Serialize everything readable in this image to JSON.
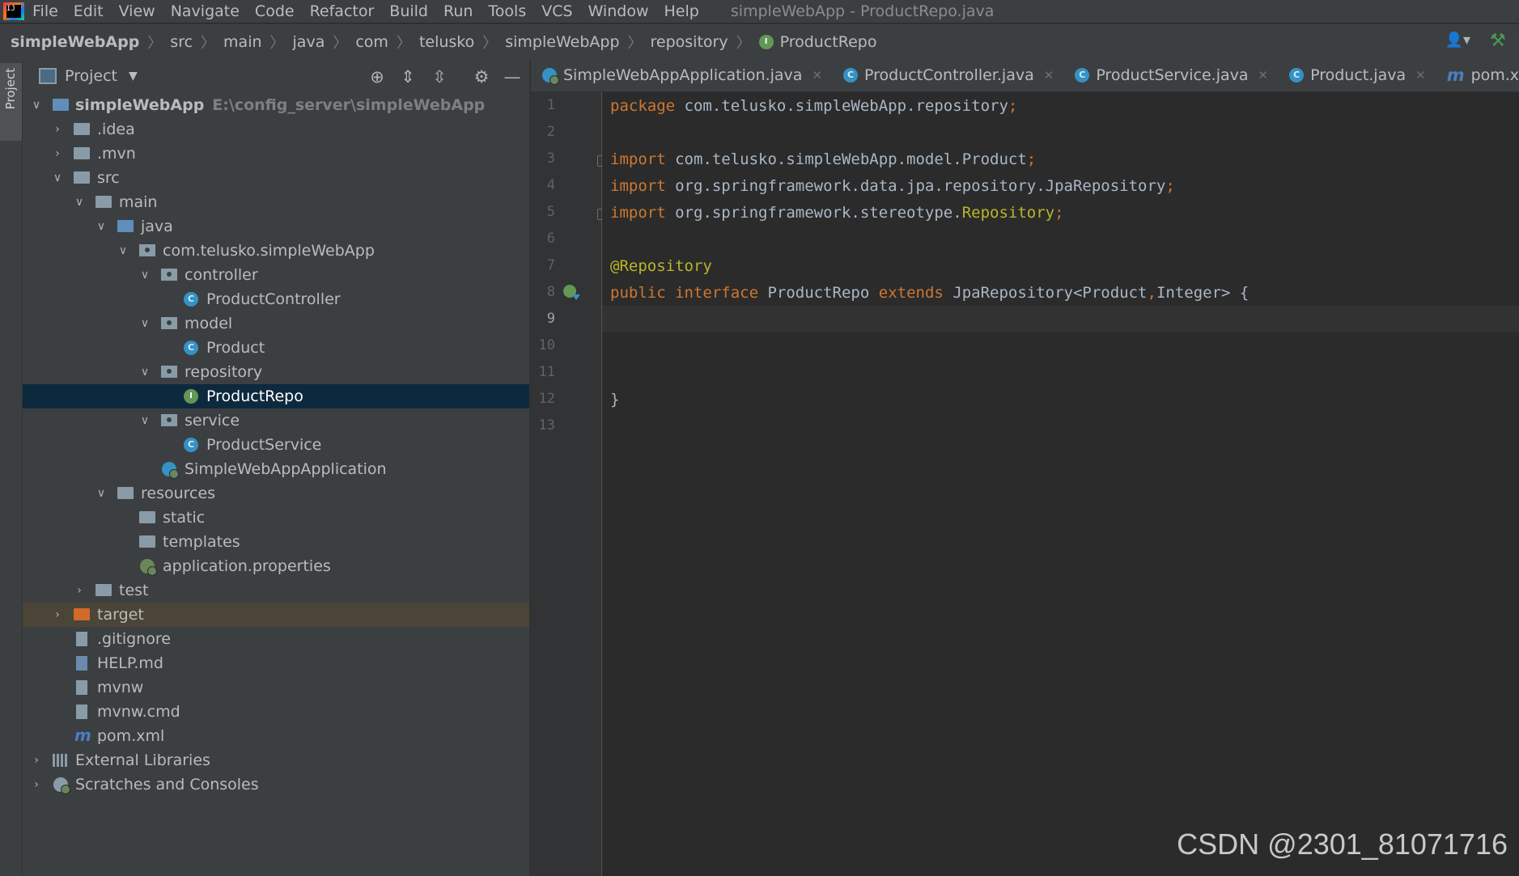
{
  "menu": {
    "items": [
      "File",
      "Edit",
      "View",
      "Navigate",
      "Code",
      "Refactor",
      "Build",
      "Run",
      "Tools",
      "VCS",
      "Window",
      "Help"
    ],
    "window_title": "simpleWebApp - ProductRepo.java"
  },
  "breadcrumb": [
    "simpleWebApp",
    "src",
    "main",
    "java",
    "com",
    "telusko",
    "simpleWebApp",
    "repository",
    "ProductRepo"
  ],
  "left_strip": {
    "project_tab": "Project"
  },
  "project_panel": {
    "title": "Project",
    "tree": [
      {
        "label": "simpleWebApp",
        "path": "E:\\config_server\\simpleWebApp"
      },
      {
        "label": ".idea"
      },
      {
        "label": ".mvn"
      },
      {
        "label": "src"
      },
      {
        "label": "main"
      },
      {
        "label": "java"
      },
      {
        "label": "com.telusko.simpleWebApp"
      },
      {
        "label": "controller"
      },
      {
        "label": "ProductController"
      },
      {
        "label": "model"
      },
      {
        "label": "Product"
      },
      {
        "label": "repository"
      },
      {
        "label": "ProductRepo"
      },
      {
        "label": "service"
      },
      {
        "label": "ProductService"
      },
      {
        "label": "SimpleWebAppApplication"
      },
      {
        "label": "resources"
      },
      {
        "label": "static"
      },
      {
        "label": "templates"
      },
      {
        "label": "application.properties"
      },
      {
        "label": "test"
      },
      {
        "label": "target"
      },
      {
        "label": ".gitignore"
      },
      {
        "label": "HELP.md"
      },
      {
        "label": "mvnw"
      },
      {
        "label": "mvnw.cmd"
      },
      {
        "label": "pom.xml"
      },
      {
        "label": "External Libraries"
      },
      {
        "label": "Scratches and Consoles"
      }
    ]
  },
  "tabs": [
    {
      "label": "SimpleWebAppApplication.java"
    },
    {
      "label": "ProductController.java"
    },
    {
      "label": "ProductService.java"
    },
    {
      "label": "Product.java"
    },
    {
      "label": "pom.xml (simpleWebApp)"
    }
  ],
  "editor": {
    "line_numbers": [
      "1",
      "2",
      "3",
      "4",
      "5",
      "6",
      "7",
      "8",
      "9",
      "10",
      "11",
      "12",
      "13"
    ],
    "current_line": "9",
    "code": {
      "l1_kw": "package",
      "l1_rest": " com.telusko.simpleWebApp.repository",
      "l3_kw": "import",
      "l3_rest": " com.telusko.simpleWebApp.model.Product",
      "l4_kw": "import",
      "l4_rest": " org.springframework.data.jpa.repository.JpaRepository",
      "l5_kw": "import",
      "l5_rest": " org.springframework.stereotype.",
      "l5_ann": "Repository",
      "semi": ";",
      "l7_ann": "@Repository",
      "l8_kw1": "public interface",
      "l8_name": " ProductRepo ",
      "l8_kw2": "extends",
      "l8_type": " JpaRepository<Product",
      "l8_comma": ",",
      "l8_rest": "Integer> {",
      "l12": "}"
    }
  },
  "watermark": "CSDN @2301_81071716",
  "colors": {
    "keyword": "#cc7832",
    "annotation": "#bbb529",
    "text": "#a9b7c6",
    "selection": "#0d293e"
  }
}
